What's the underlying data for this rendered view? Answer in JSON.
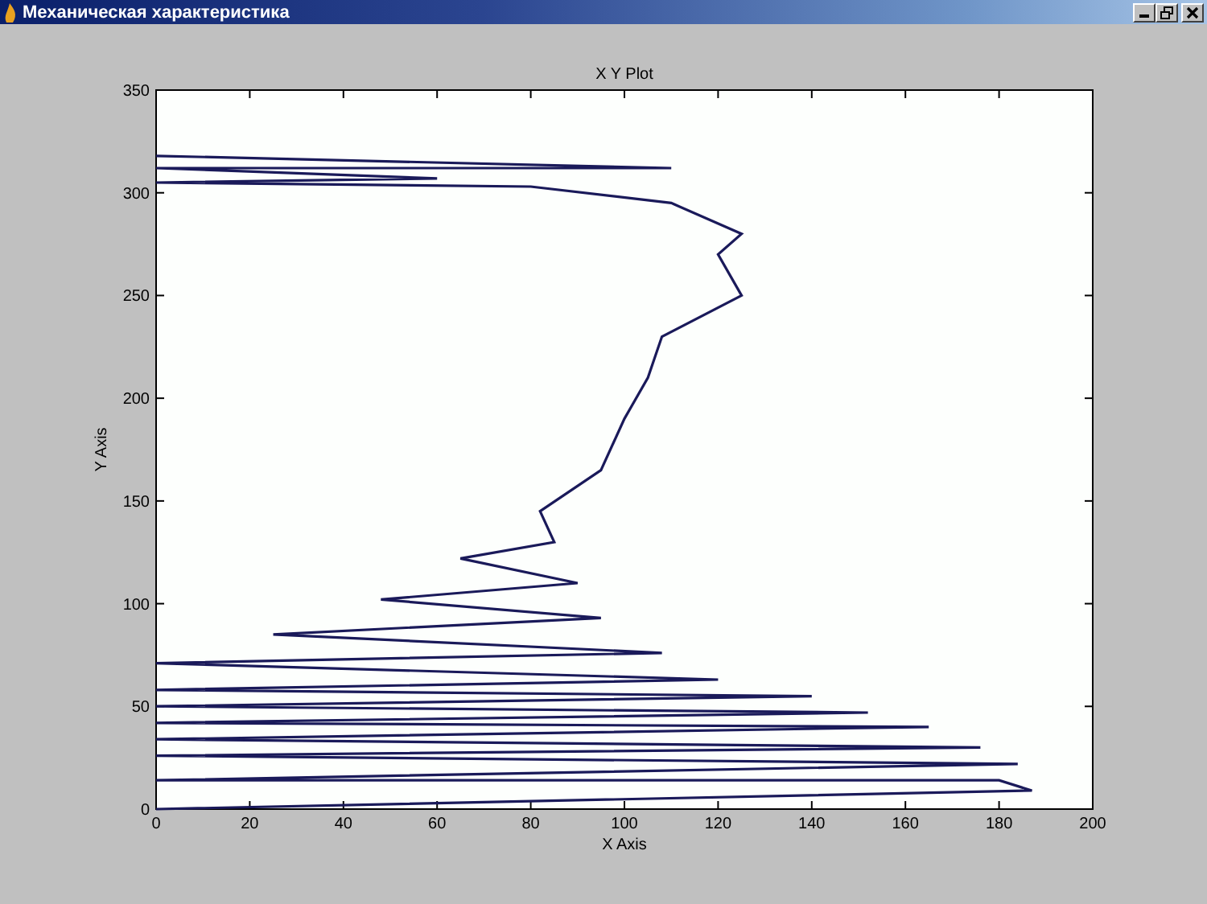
{
  "window": {
    "title": "Механическая характеристика"
  },
  "chart_data": {
    "type": "line",
    "title": "X Y Plot",
    "xlabel": "X Axis",
    "ylabel": "Y Axis",
    "xlim": [
      0,
      200
    ],
    "ylim": [
      0,
      350
    ],
    "xticks": [
      0,
      20,
      40,
      60,
      80,
      100,
      120,
      140,
      160,
      180,
      200
    ],
    "yticks": [
      0,
      50,
      100,
      150,
      200,
      250,
      300,
      350
    ],
    "x": [
      0,
      187,
      180,
      0,
      184,
      0,
      176,
      0,
      165,
      0,
      152,
      0,
      140,
      0,
      120,
      0,
      108,
      25,
      95,
      48,
      90,
      65,
      85,
      82,
      95,
      100,
      105,
      108,
      125,
      120,
      125,
      110,
      80,
      0,
      60,
      0,
      110,
      0
    ],
    "series": [
      {
        "color": "#1a1a5a",
        "values": [
          0,
          9,
          14,
          14,
          22,
          26,
          30,
          34,
          40,
          42,
          47,
          50,
          55,
          58,
          63,
          71,
          76,
          85,
          93,
          102,
          110,
          122,
          130,
          145,
          165,
          190,
          210,
          230,
          250,
          270,
          280,
          295,
          303,
          305,
          307,
          312,
          312,
          318
        ]
      }
    ]
  }
}
